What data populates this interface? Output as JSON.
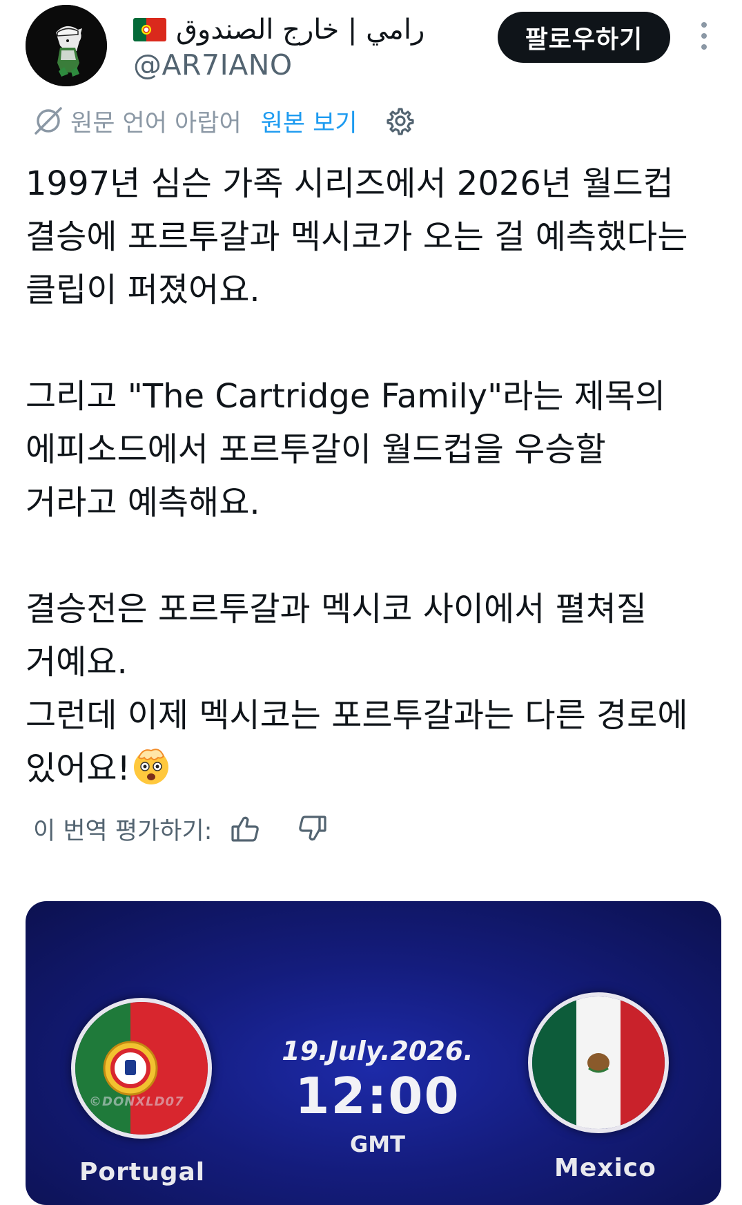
{
  "author": {
    "display_name": "رامي | خارج الصندوق",
    "handle": "@AR7IANO",
    "flag_icon": "portugal-flag-emoji"
  },
  "actions": {
    "follow_label": "팔로우하기",
    "more_icon": "vertical-ellipsis"
  },
  "translation": {
    "language_note": "원문 언어 아랍어",
    "show_original_label": "원본 보기",
    "rate_label": "이 번역 평가하기:"
  },
  "tweet": {
    "paragraph_1": "1997년 심슨 가족 시리즈에서 2026년 월드컵\n결승에 포르투갈과 멕시코가 오는 걸 예측했다는\n클립이 퍼졌어요.",
    "paragraph_2": "그리고 \"The Cartridge Family\"라는 제목의\n에피소드에서 포르투갈이 월드컵을 우승할\n거라고 예측해요.",
    "paragraph_3": "결승전은 포르투갈과 멕시코 사이에서 펼쳐질\n거예요.\n그런데 이제 멕시코는 포르투갈과는 다른 경로에\n있어요!",
    "emoji": "shocked-face-emoji"
  },
  "media": {
    "team_left": "Portugal",
    "team_right": "Mexico",
    "date": "19.July.2026.",
    "time": "12:00",
    "timezone": "GMT",
    "watermark": "©DONXLD07"
  },
  "colors": {
    "link": "#1d9bf0",
    "text": "#0f1419",
    "muted": "#536471",
    "follow_bg": "#0f1419",
    "media_bg": "#141c7c"
  }
}
